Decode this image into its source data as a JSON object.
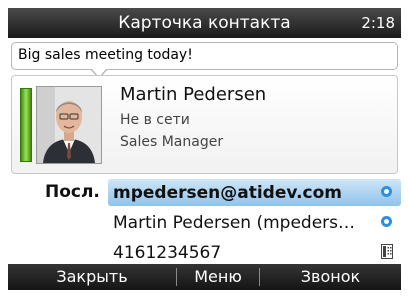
{
  "header": {
    "title": "Карточка контакта",
    "time": "2:18"
  },
  "status_message": "Big sales meeting today!",
  "contact": {
    "name": "Martin Pedersen",
    "presence": "Не в сети",
    "job_title": "Sales Manager",
    "presence_color": "#5cc22a"
  },
  "details": {
    "label": "Посл.",
    "rows": [
      {
        "text": "mpedersen@atidev.com",
        "icon": "sync-icon",
        "selected": true
      },
      {
        "text": "Martin Pedersen (mpeders…",
        "icon": "sync-icon",
        "selected": false
      },
      {
        "text": "4161234567",
        "icon": "phone-icon",
        "selected": false
      }
    ]
  },
  "softkeys": {
    "close": "Закрыть",
    "menu": "Меню",
    "call": "Звонок"
  },
  "colors": {
    "accent": "#2d8fe0",
    "selection": "#8fc3ea"
  }
}
